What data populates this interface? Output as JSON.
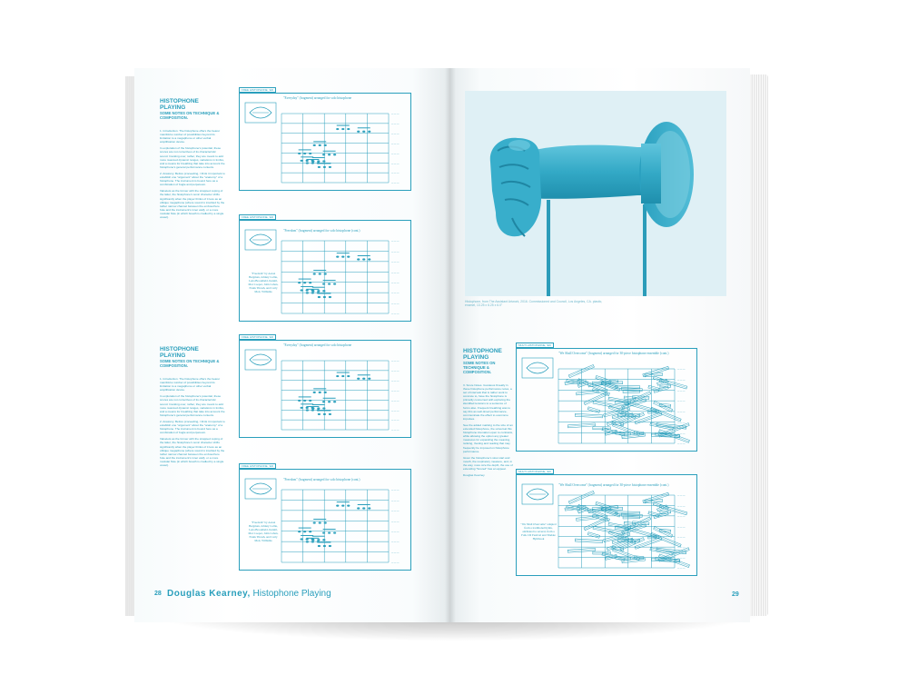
{
  "left_page": {
    "page_number": "28",
    "footer_author": "Douglas Kearney,",
    "footer_title": "Histophone Playing",
    "sections": [
      {
        "heading": "HISTOPHONE PLAYING",
        "subheading": "SOME NOTES ON TECHNIQUE & COMPOSITION.",
        "paragraphs": [
          "1. Introduction. The histophone offers the bearer manifold a number of possibilities beyond its limitation to a megaphone or other verbal amplification device.",
          "In exploration of the histophone's potential, these scores are not correctives of its characteristic sound. Invoking over, rather, they are meant to add more nuanced dynamic ranges, variations in timbre, and a means for breathing that take into account the histophone's general performance contexts.",
          "2. Anatomy. Before proceeding, I think it important to establish one \"argument\" about the \"anatomy\" of a histophone. The instrument is bound here as a combination of bugle and perpetuum.",
          "Valvelets as the former with the strapped coping of the latter, the histophone's sonic character shifts significantly when the player thinks of it less as an oblique megaphone (where sound is troubled by the rather narrow channel between the embouchure hole and the instrument's inner wall), or a more modular flute (in which breath is cradled by a single vowel)."
        ]
      },
      {
        "heading": "HISTOPHONE PLAYING",
        "subheading": "SOME NOTES ON TECHNIQUE & COMPOSITION.",
        "paragraphs": [
          "1. Introduction. The histophone offers the bearer manifold a number of possibilities beyond its limitation to a megaphone or other verbal amplification device.",
          "In exploration of the histophone's potential, these scores are not correctives of its characteristic sound. Invoking over, rather, they are meant to add more nuanced dynamic ranges, variations in timbre, and a means for breathing that take into account the histophone's general performance contexts.",
          "2. Anatomy. Before proceeding, I think it important to establish one \"argument\" about the \"anatomy\" of a histophone. The instrument is bound here as a combination of bugle and perpetuum.",
          "Valvelets as the former with the strapped coping of the latter, the histophone's sonic character shifts significantly when the player thinks of it less as an oblique megaphone (where sound is troubled by the rather narrow channel between the embouchure hole and the instrument's inner wall), or a more modular flute (in which breath is cradled by a single vowel)."
        ]
      }
    ],
    "scores": [
      {
        "label": "FREE HISTOPHONE, 'ED",
        "caption": "\"Everyday\" (fragment) arranged for solo histophone",
        "credit": ""
      },
      {
        "label": "FREE HISTOPHONE, 'ED",
        "caption": "\"Freedom\" (fragment) arranged for solo histophone (cont.)",
        "credit": "\"Freedom\" by Aaron Bergman, Johnny Collie, Lena Brookheld, Kennil, Mar Cooper, John Cohen, Frank Thrash, and Carly Mott, Williams"
      },
      {
        "label": "FREE HISTOPHONE, 'ED",
        "caption": "\"Everyday\" (fragment) arranged for solo histophone",
        "credit": ""
      },
      {
        "label": "FREE HISTOPHONE, 'ED",
        "caption": "\"Freedom\" (fragment) arranged for solo histophone (cont.)",
        "credit": "\"Freedom\" by Aaron Bergman, Johnny Collie, Lena Brookheld, Kennil, Mar Cooper, John Cohen, Frank Thrash, and Carly Mott, Williams"
      }
    ]
  },
  "right_page": {
    "page_number": "29",
    "photo_caption": "Histophone, from The Assistant Artwork, 2016. Commissioned and Council, Los Angeles, CA. plastic, enamel, 13.25 x 6.25 x 6.0\"",
    "section": {
      "heading": "HISTOPHONE PLAYING",
      "subheading": "SOME NOTES ON TECHNIQUE & COMPOSITION.",
      "paragraphs": [
        "3. Score Notes. Gustavus Kneally in these histophone performance notes, a set of intervals that is rather work to concrete to, have the histophone is primarily concerned with exploring the identified tensions to a sentence of forms also. Frequent breathing was to say this as well-timed performance, communicate the effect to overcome impulses.",
        "See the added marking to the size of an extended histophone, the universal this histophone intonation open to contrasts, while allowing the option any greater measures for expanding the meaning, ranking, riveting and reading that may frequently be imposed on histophone performance.",
        "Given the histophone's slow start and mouth, the respiratory measure, and, in the way, more size the depth, the use of extending \"Scored\" has an appeal.",
        "Douglas Kearney"
      ]
    },
    "scores": [
      {
        "label": "MULTI HISTOPHONE, 'ED",
        "caption": "\"We Shall Overcome\" (fragment) arranged for 30-piece histophone ensemble (cont.)",
        "credit": ""
      },
      {
        "label": "MULTI HISTOPHONE, 'ED",
        "caption": "\"We Shall Overcome\" (fragment) arranged for 30-piece histophone ensemble (cont.)",
        "credit": "\"We Shall Overcome\" adapted from a traditional hymn, attributed to several, from a Folk CD Festival and Tindale Hymbook"
      }
    ]
  },
  "colors": {
    "ink": "#2a9fbc",
    "photo_bg": "#dff0f5",
    "photo_object": "#3fb3cf"
  }
}
